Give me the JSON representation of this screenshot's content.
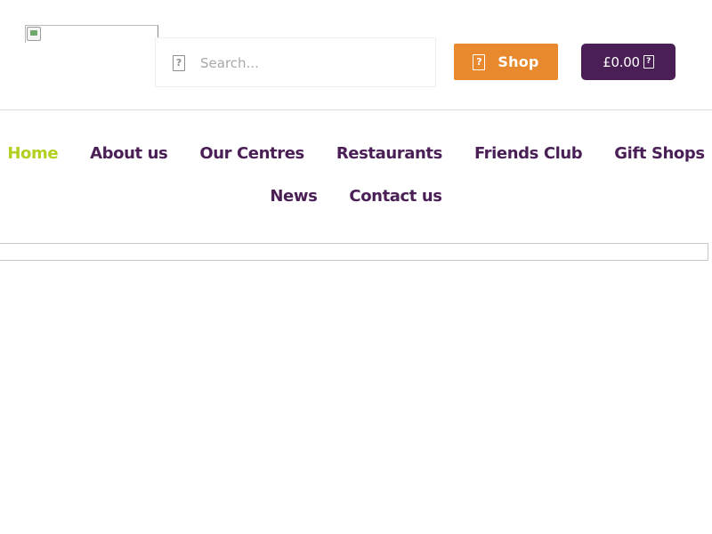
{
  "header": {
    "search": {
      "placeholder": "Search...",
      "value": "",
      "icon": "search-icon"
    },
    "shop_button": {
      "label": "Shop",
      "icon": "shop-icon",
      "color": "#e8892e"
    },
    "cart": {
      "total": "£0.00",
      "icon": "cart-icon",
      "color": "#4a1f56"
    }
  },
  "nav": {
    "active_color": "#b3cf1f",
    "color": "#4a1f56",
    "row1": [
      {
        "label": "Home",
        "active": true
      },
      {
        "label": "About us",
        "active": false
      },
      {
        "label": "Our Centres",
        "active": false
      },
      {
        "label": "Restaurants",
        "active": false
      },
      {
        "label": "Friends Club",
        "active": false
      },
      {
        "label": "Gift Shops",
        "active": false
      }
    ],
    "row2": [
      {
        "label": "News",
        "active": false
      },
      {
        "label": "Contact us",
        "active": false
      }
    ]
  }
}
